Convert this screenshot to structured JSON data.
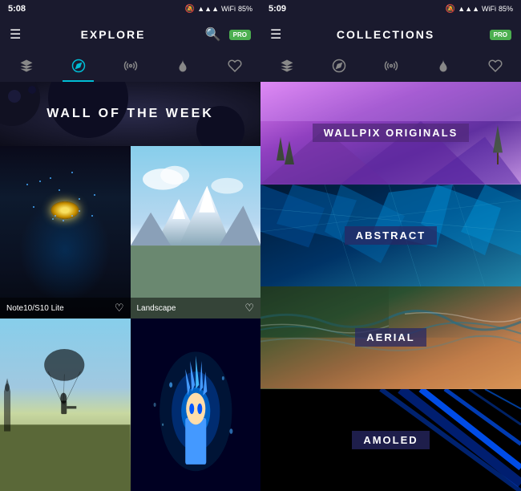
{
  "left": {
    "status": {
      "time": "5:08",
      "battery": "85%"
    },
    "header": {
      "title": "EXPLORE",
      "menu_label": "☰",
      "search_label": "🔍"
    },
    "tabs": [
      {
        "label": "layers",
        "icon": "⊞",
        "active": false
      },
      {
        "label": "compass",
        "icon": "◎",
        "active": true
      },
      {
        "label": "radio",
        "icon": "◉",
        "active": false
      },
      {
        "label": "flame",
        "icon": "🔥",
        "active": false
      },
      {
        "label": "heart",
        "icon": "♡",
        "active": false
      }
    ],
    "banner": {
      "text": "WALL OF THE WEEK"
    },
    "grid": [
      {
        "id": "avatar",
        "label": "Note10/S10 Lite",
        "has_heart": true,
        "row": 0,
        "col": 0
      },
      {
        "id": "landscape",
        "label": "Landscape",
        "has_heart": true,
        "row": 0,
        "col": 1
      },
      {
        "id": "pubg",
        "label": "",
        "has_heart": false,
        "row": 1,
        "col": 0
      },
      {
        "id": "anime",
        "label": "",
        "has_heart": false,
        "row": 1,
        "col": 1
      }
    ]
  },
  "right": {
    "status": {
      "time": "5:09",
      "battery": "85%"
    },
    "header": {
      "title": "COLLECTIONS",
      "menu_label": "☰"
    },
    "tabs": [
      {
        "label": "layers",
        "icon": "⊞",
        "active": false
      },
      {
        "label": "compass",
        "icon": "◎",
        "active": false
      },
      {
        "label": "radio",
        "icon": "◉",
        "active": false
      },
      {
        "label": "flame",
        "icon": "🔥",
        "active": false
      },
      {
        "label": "heart",
        "icon": "♡",
        "active": false
      }
    ],
    "collections": [
      {
        "id": "wallpix",
        "label": "WALLPIX ORIGINALS"
      },
      {
        "id": "abstract",
        "label": "ABSTRACT"
      },
      {
        "id": "aerial",
        "label": "AERIAL"
      },
      {
        "id": "amoled",
        "label": "AMOLED"
      }
    ]
  },
  "icons": {
    "hamburger": "☰",
    "search": "🔍",
    "pro_label": "PRO",
    "heart_empty": "♡",
    "heart_filled": "♥",
    "layers": "❑",
    "compass": "⊙",
    "waves": "≋",
    "flame": "🔥",
    "signal": "▲▲▲",
    "wifi": "WiFi",
    "battery": "🔋"
  }
}
